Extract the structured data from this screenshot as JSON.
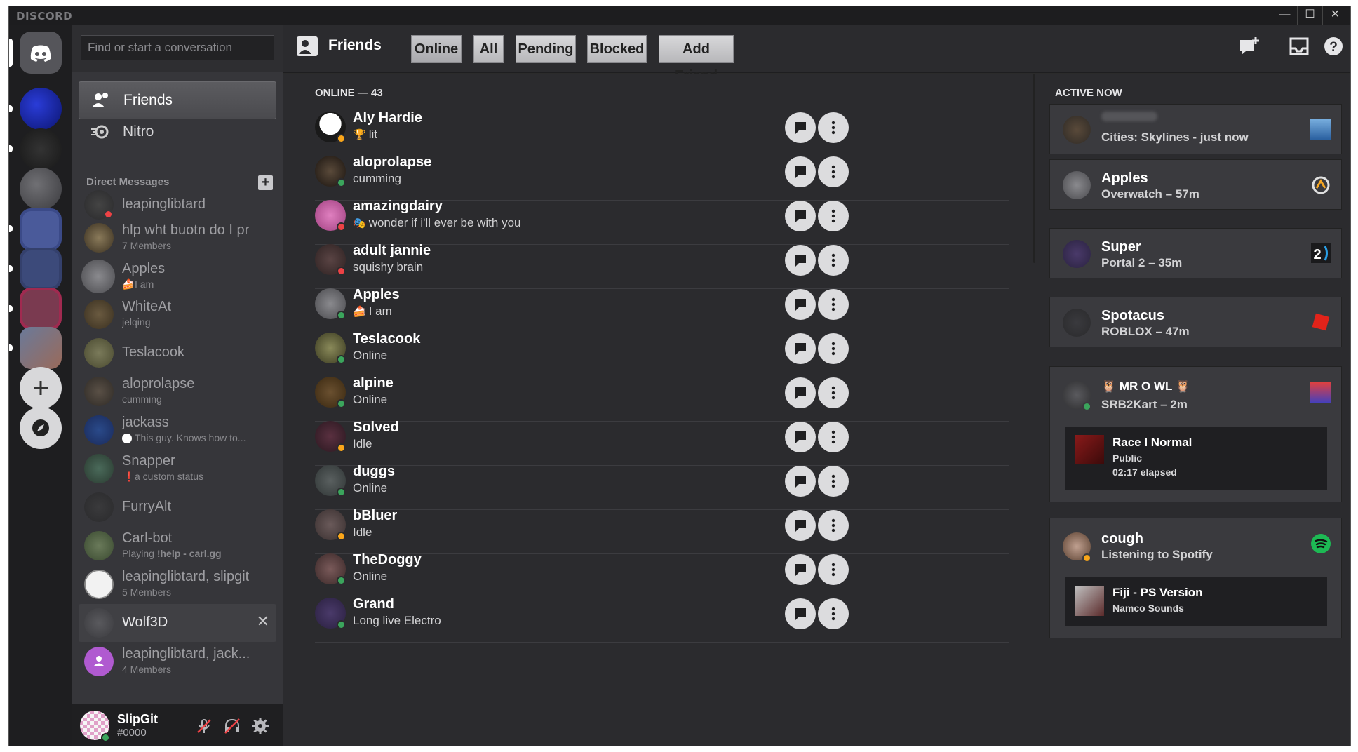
{
  "app": {
    "brand": "DISCORD"
  },
  "window_controls": {
    "minimize": "—",
    "maximize": "☐",
    "close": "✕"
  },
  "search": {
    "placeholder": "Find or start a conversation"
  },
  "nav": {
    "friends": "Friends",
    "nitro": "Nitro"
  },
  "direct_messages": {
    "header": "Direct Messages",
    "add": "+",
    "items": [
      {
        "name": "leapinglibtard",
        "sub": ""
      },
      {
        "name": "hlp wht buotn do I pr",
        "sub": "7 Members"
      },
      {
        "name": "Apples",
        "sub": "I am"
      },
      {
        "name": "WhiteAt",
        "sub": "jelqing"
      },
      {
        "name": "Teslacook",
        "sub": ""
      },
      {
        "name": "aloprolapse",
        "sub": "cumming"
      },
      {
        "name": "jackass",
        "sub": "This guy. Knows how to..."
      },
      {
        "name": "Snapper",
        "sub": "a custom status"
      },
      {
        "name": "FurryAlt",
        "sub": ""
      },
      {
        "name": "Carl-bot",
        "sub_prefix": "Playing ",
        "sub": "!help - carl.gg"
      },
      {
        "name": "leapinglibtard, slipgit",
        "sub": "5 Members"
      },
      {
        "name": "Wolf3D",
        "sub": ""
      },
      {
        "name": "leapinglibtard, jack...",
        "sub": "4 Members"
      }
    ],
    "close_glyph": "✕"
  },
  "user": {
    "name": "SlipGit",
    "tag": "#0000"
  },
  "toolbar": {
    "title": "Friends",
    "tabs": [
      "Online",
      "All",
      "Pending",
      "Blocked",
      "Add Friend"
    ],
    "icons": [
      "new-group-dm-icon",
      "inbox-icon",
      "help-icon"
    ]
  },
  "online": {
    "header": "ONLINE — 43",
    "friends": [
      {
        "name": "Aly Hardie",
        "status": "lit",
        "emoji": true
      },
      {
        "name": "aloprolapse",
        "status": "cumming"
      },
      {
        "name": "amazingdairy",
        "status": "wonder if i'll ever be with you",
        "emoji": true
      },
      {
        "name": "adult jannie",
        "status": "squishy brain"
      },
      {
        "name": "Apples",
        "status": "I am",
        "emoji": true
      },
      {
        "name": "Teslacook",
        "status": "Online"
      },
      {
        "name": "alpine",
        "status": "Online"
      },
      {
        "name": "Solved",
        "status": "Idle"
      },
      {
        "name": "duggs",
        "status": "Online"
      },
      {
        "name": "bBluer",
        "status": "Idle"
      },
      {
        "name": "TheDoggy",
        "status": "Online"
      },
      {
        "name": "Grand",
        "status": "Long live Electro"
      }
    ]
  },
  "active_now": {
    "header": "ACTIVE NOW",
    "cards": [
      {
        "name": "",
        "status": "Cities: Skylines - just now",
        "icon": "cities-skylines-icon"
      },
      {
        "name": "Apples",
        "status": "Overwatch – 57m",
        "icon": "overwatch-icon"
      },
      {
        "name": "Super",
        "status": "Portal 2 – 35m",
        "icon": "portal2-icon"
      },
      {
        "name": "Spotacus",
        "status": "ROBLOX – 47m",
        "icon": "roblox-icon"
      },
      {
        "name": "🦉 MR O WL 🦉",
        "status": "SRB2Kart – 2m",
        "icon": "srb2kart-icon",
        "detail": {
          "title": "Race I Normal",
          "line2": "Public",
          "line3": "02:17 elapsed"
        }
      },
      {
        "name": "cough",
        "status": "Listening to Spotify",
        "icon": "spotify-icon",
        "detail": {
          "title": "Fiji - PS Version",
          "line2": "Namco Sounds"
        }
      }
    ]
  },
  "colors": {
    "online": "#3ba55c",
    "idle": "#faa61a",
    "dnd": "#ed4245",
    "spotify": "#1db954",
    "roblox": "#e2231a"
  }
}
